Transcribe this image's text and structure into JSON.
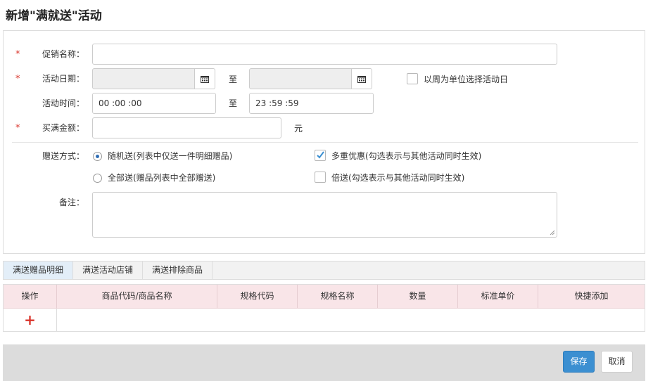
{
  "page": {
    "title": "新增\"满就送\"活动"
  },
  "form": {
    "promo_name": {
      "label": "促销名称：",
      "required": "*",
      "value": ""
    },
    "date": {
      "label": "活动日期：",
      "required": "*",
      "start_value": "",
      "end_value": "",
      "to_label": "至",
      "icon": "calendar-icon",
      "week_checkbox_label": "以周为单位选择活动日",
      "week_checked": false
    },
    "time": {
      "label": "活动时间：",
      "start_value": "00 :00 :00",
      "to_label": "至",
      "end_value": "23 :59 :59"
    },
    "amount": {
      "label": "买满金额：",
      "required": "*",
      "value": "",
      "unit": "元"
    },
    "gift_mode": {
      "label": "赠送方式：",
      "options": [
        {
          "label": "随机送(列表中仅送一件明细赠品)",
          "checked": true
        },
        {
          "label": "全部送(赠品列表中全部赠送)",
          "checked": false
        }
      ]
    },
    "multi_offer": {
      "label": "多重优惠(勾选表示与其他活动同时生效)",
      "checked": true
    },
    "double_gift": {
      "label": "倍送(勾选表示与其他活动同时生效)",
      "checked": false
    },
    "remark": {
      "label": "备注：",
      "value": ""
    }
  },
  "tabs": [
    {
      "label": "满送赠品明细",
      "active": true
    },
    {
      "label": "满送活动店铺",
      "active": false
    },
    {
      "label": "满送排除商品",
      "active": false
    }
  ],
  "grid": {
    "columns": [
      "操作",
      "商品代码/商品名称",
      "规格代码",
      "规格名称",
      "数量",
      "标准单价",
      "快捷添加"
    ],
    "add_symbol": "+"
  },
  "footer": {
    "save_label": "保存",
    "cancel_label": "取消"
  },
  "colors": {
    "required": "#d9342b",
    "primary": "#3b8fd1",
    "grid_header": "#f9e5e8",
    "active_tab": "#e3eef8"
  }
}
